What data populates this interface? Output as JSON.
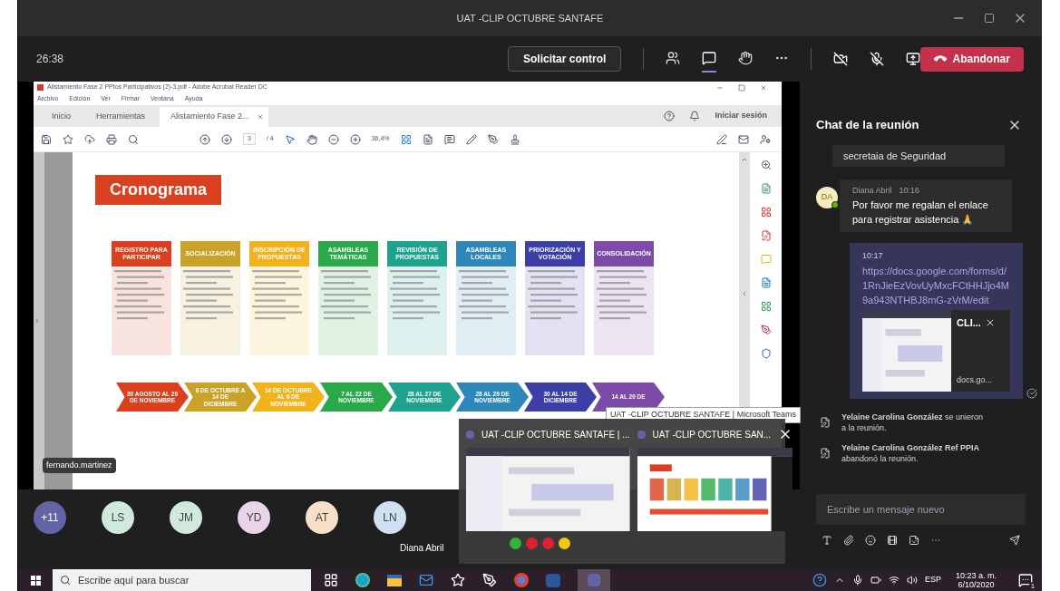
{
  "window": {
    "title": "UAT -CLIP OCTUBRE SANTAFE"
  },
  "toolbar": {
    "timer": "26:38",
    "request_button": "Solicitar control",
    "icons": [
      {
        "kind": "people",
        "selected": false
      },
      {
        "kind": "chat",
        "selected": true
      },
      {
        "kind": "hand",
        "selected": false
      },
      {
        "kind": "more",
        "selected": false
      }
    ],
    "leave_button": "Abandonar"
  },
  "acrobat": {
    "title": "Alistamiento Fase 2 PPtos Participativos (2)-3.pdf - Adobe Acrobat Reader DC",
    "menu": [
      "Archivo",
      "Edición",
      "Ver",
      "Firmar",
      "Ventana",
      "Ayuda"
    ],
    "tabs": [
      {
        "label": "Inicio",
        "selected": false
      },
      {
        "label": "Herramientas",
        "selected": false
      },
      {
        "label": "Alistamiento Fase 2...",
        "selected": true
      }
    ],
    "sign_in": "Iniciar sesión",
    "page": "3",
    "page_total": "/ 4",
    "zoom": "36,4%"
  },
  "cronograma": {
    "title": "Cronograma",
    "phases": [
      {
        "heading": "REGISTRO PARA PARTICIPAR",
        "color": "#d8401f"
      },
      {
        "heading": "SOCIALIZACIÓN",
        "color": "#c9a227"
      },
      {
        "heading": "INSCRIPCIÓN DE PROPUESTAS",
        "color": "#f2b21b"
      },
      {
        "heading": "ASAMBLEAS TEMÁTICAS",
        "color": "#2aa84a"
      },
      {
        "heading": "REVISIÓN DE PROPUESTAS",
        "color": "#1fa38f"
      },
      {
        "heading": "ASAMBLEAS LOCALES",
        "color": "#2f86b8"
      },
      {
        "heading": "PRIORIZACIÓN Y VOTACIÓN",
        "color": "#3b3fa6"
      },
      {
        "heading": "CONSOLIDACIÓN",
        "color": "#7e4aa8"
      }
    ],
    "dates": [
      {
        "label": "30 AGOSTO AL 29 DE NOVIEMBRE",
        "color": "#d8401f"
      },
      {
        "label": "8 DE OCTUBRE A 14 DE DICIEMBRE",
        "color": "#c9a227"
      },
      {
        "label": "14 DE OCTUBRE AL 6 DE NOVIEMBRE",
        "color": "#f2b21b"
      },
      {
        "label": "7 AL 22 DE NOVIEMBRE",
        "color": "#2aa84a"
      },
      {
        "label": "28 AL 27 DE NOVIEMBRE",
        "color": "#1fa38f"
      },
      {
        "label": "28 AL 29 DE NOVIEMBRE",
        "color": "#2f86b8"
      },
      {
        "label": "30 AL 14 DE DICIEMBRE",
        "color": "#3b3fa6"
      },
      {
        "label": "14 AL 20 DE",
        "color": "#7e4aa8"
      }
    ]
  },
  "presenter": "fernando.martinez",
  "participants": [
    {
      "initials": "+11",
      "color": "#6264a7"
    },
    {
      "initials": "LS",
      "color": "#cfe9dd"
    },
    {
      "initials": "JM",
      "color": "#cfe9dd"
    },
    {
      "initials": "YD",
      "color": "#e8d3e8"
    },
    {
      "initials": "AT",
      "color": "#f8e0c8"
    },
    {
      "initials": "LN",
      "color": "#cfe0f2"
    }
  ],
  "speaker": "Diana Abril",
  "tooltip": "UAT -CLIP OCTUBRE SANTAFE | Microsoft Teams",
  "preview": {
    "windows": [
      {
        "title": "UAT -CLIP OCTUBRE SANTAFE | ..."
      },
      {
        "title": "UAT -CLIP OCTUBRE SAN..."
      }
    ],
    "dots": [
      {
        "color": "#2fb53a"
      },
      {
        "color": "#e02030"
      },
      {
        "color": "#e02030"
      },
      {
        "color": "#f2c811"
      }
    ]
  },
  "chat": {
    "title": "Chat de la reunión",
    "prev_message": "secretaia de Seguridad",
    "message": {
      "initials": "DA",
      "author": "Diana Abril",
      "time": "10:16",
      "text": "Por favor me regalan el enlace para registrar asistencia 🙏"
    },
    "own_message": {
      "time": "10:17",
      "link": "https://docs.google.com/forms/d/1RnJieEzVovUyMxcFCtHHJjo4M9a943NTHBJ8mG-zVrM/edit",
      "card_title": "CLI...",
      "card_domain": "docs.go..."
    },
    "events": [
      "**Yelaine Carolina González** se unieron a la reunión.",
      "**Yelaine Carolina González Ref PPIA** abandonó la reunión."
    ],
    "compose_placeholder": "Escribe un mensaje nuevo"
  },
  "taskbar": {
    "search_placeholder": "Escribe aquí para buscar",
    "language": "ESP",
    "time": "10:23 a. m.",
    "date": "6/10/2020",
    "notification_count": "1"
  }
}
